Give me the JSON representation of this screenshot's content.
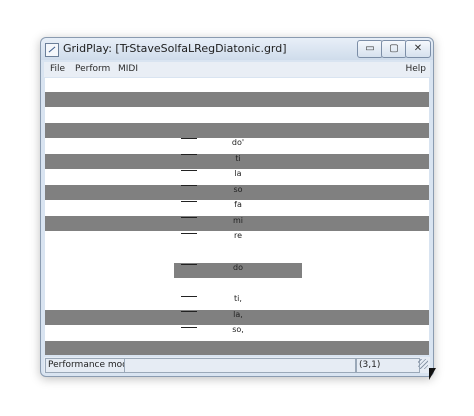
{
  "window": {
    "title": "GridPlay: [TrStaveSolfaLRegDiatonic.grd]",
    "buttons": {
      "minimize": "▭",
      "maximize": "▢",
      "close": "✕"
    }
  },
  "menu": {
    "file": "File",
    "perform": "Perform",
    "midi": "MIDI",
    "help": "Help"
  },
  "grid": {
    "notes": [
      "do'",
      "ti",
      "la",
      "so",
      "fa",
      "mi",
      "re",
      "do",
      "ti,",
      "la,",
      "so,"
    ],
    "highlighted_note": "do"
  },
  "status": {
    "mode": "Performance mod",
    "position": "(3,1)"
  }
}
